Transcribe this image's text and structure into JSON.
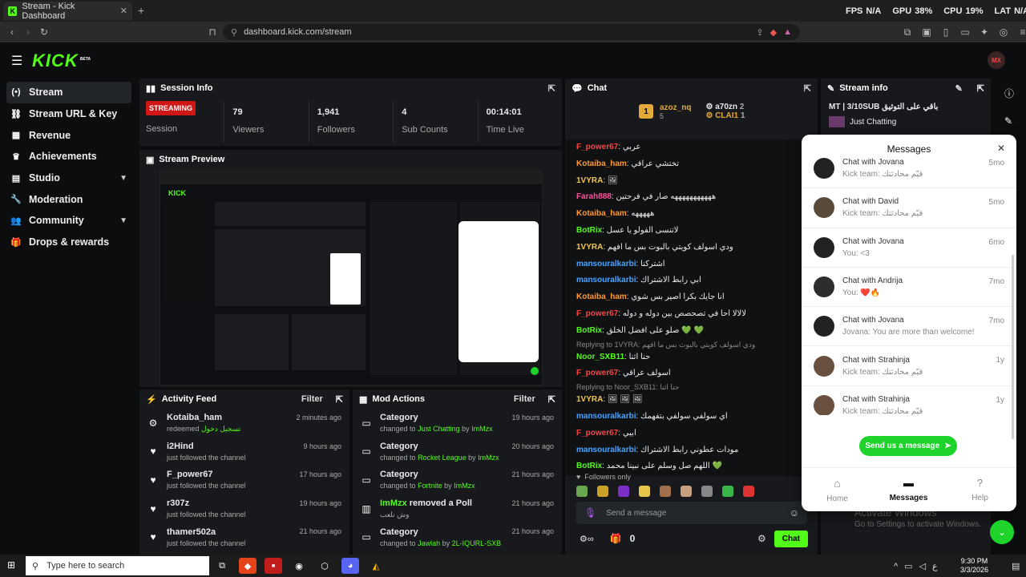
{
  "browser": {
    "tab_title": "Stream - Kick Dashboard",
    "url": "dashboard.kick.com/stream",
    "overlay": {
      "fps_label": "FPS",
      "fps": "N/A",
      "gpu_label": "GPU",
      "gpu": "38%",
      "cpu_label": "CPU",
      "cpu": "19%",
      "lat_label": "LAT",
      "lat": "N/A"
    }
  },
  "header": {
    "logo": "KICK",
    "beta": "BETA",
    "avatar": "MX"
  },
  "sidebar": {
    "items": [
      {
        "label": "Stream",
        "icon": "stream-icon"
      },
      {
        "label": "Stream URL & Key",
        "icon": "link-icon"
      },
      {
        "label": "Revenue",
        "icon": "revenue-icon"
      },
      {
        "label": "Achievements",
        "icon": "trophy-icon"
      },
      {
        "label": "Studio",
        "icon": "grid-icon"
      },
      {
        "label": "Moderation",
        "icon": "wrench-icon"
      },
      {
        "label": "Community",
        "icon": "community-icon"
      },
      {
        "label": "Drops & rewards",
        "icon": "gift-icon"
      }
    ]
  },
  "session": {
    "title": "Session Info",
    "status": "STREAMING",
    "status_label": "Session",
    "stats": [
      {
        "value": "79",
        "label": "Viewers"
      },
      {
        "value": "1,941",
        "label": "Followers"
      },
      {
        "value": "4",
        "label": "Sub Counts"
      },
      {
        "value": "00:14:01",
        "label": "Time Live"
      }
    ]
  },
  "preview": {
    "title": "Stream Preview"
  },
  "activity": {
    "title": "Activity Feed",
    "filter": "Filter",
    "items": [
      {
        "name": "Kotaiba_ham",
        "sub": "redeemed",
        "extra": "تسجيل دخول",
        "time": "2 minutes ago",
        "icon": "reward-icon"
      },
      {
        "name": "i2Hind",
        "sub": "just followed the channel",
        "time": "9 hours ago",
        "icon": "heart-icon"
      },
      {
        "name": "F_power67",
        "sub": "just followed the channel",
        "time": "17 hours ago",
        "icon": "heart-icon"
      },
      {
        "name": "r307z",
        "sub": "just followed the channel",
        "time": "19 hours ago",
        "icon": "heart-icon"
      },
      {
        "name": "thamer502a",
        "sub": "just followed the channel",
        "time": "21 hours ago",
        "icon": "heart-icon"
      }
    ]
  },
  "modactions": {
    "title": "Mod Actions",
    "filter": "Filter",
    "items": [
      {
        "title": "Category",
        "pre": "changed to",
        "target": "Just Chatting",
        "by": "by",
        "mod": "ImMzx",
        "time": "19 hours ago"
      },
      {
        "title": "Category",
        "pre": "changed to",
        "target": "Rocket League",
        "by": "by",
        "mod": "ImMzx",
        "time": "20 hours ago"
      },
      {
        "title": "Category",
        "pre": "changed to",
        "target": "Fortnite",
        "by": "by",
        "mod": "ImMzx",
        "time": "21 hours ago"
      },
      {
        "title_user": "ImMzx",
        "title": "removed a Poll",
        "pre": "وش نلعب",
        "target": "",
        "by": "",
        "mod": "",
        "time": "21 hours ago"
      },
      {
        "title": "Category",
        "pre": "changed to",
        "target": "Jawlah",
        "by": "by",
        "mod": "2L-IQURL-SXB",
        "time": "21 hours ago"
      }
    ]
  },
  "chat": {
    "title": "Chat",
    "top": [
      {
        "rank": "1",
        "name": "azoz_nq",
        "count": "5"
      },
      {
        "name": "a70zn",
        "count": "2"
      },
      {
        "name": "CLAI1",
        "count": "1"
      }
    ],
    "messages": [
      {
        "user": "F_power67",
        "color": "#ff4444",
        "text": "عربي"
      },
      {
        "user": "Kotaiba_ham",
        "color": "#ff9a2b",
        "text": "تختشي عراقي"
      },
      {
        "user": "1VYRA",
        "color": "#f2c94c",
        "text": "🖼"
      },
      {
        "user": "Farah888",
        "color": "#ff4d9d",
        "text": "هههههههههههه صار في فرحتين"
      },
      {
        "user": "Kotaiba_ham",
        "color": "#ff9a2b",
        "text": "هههههه"
      },
      {
        "user": "BotRix",
        "color": "#53fc18",
        "text": "لاتنسى الفولو يا عسل"
      },
      {
        "user": "1VYRA",
        "color": "#f2c94c",
        "text": "ودي اسولف كويتي بالبوت بس ما افهم"
      },
      {
        "user": "mansouralkarbi",
        "color": "#4aa3ff",
        "text": "اشتركنا"
      },
      {
        "user": "mansouralkarbi",
        "color": "#4aa3ff",
        "text": "ابي رابط الاشتراك"
      },
      {
        "user": "Kotaiba_ham",
        "color": "#ff9a2b",
        "text": "انا جايك بكرا اصير بس شوي"
      },
      {
        "user": "F_power67",
        "color": "#ff4444",
        "text": "لالالا احا في تصحصص بين دوله و دوله"
      },
      {
        "user": "BotRix",
        "color": "#53fc18",
        "text": "صلو على افضل الخلق 💚 💚"
      },
      {
        "reply": "Replying to 1VYRA: ودي اسولف كويتي بالبوت بس ما افهم"
      },
      {
        "user": "Noor_SXB11",
        "color": "#53fc18",
        "text": "حنا اثنا"
      },
      {
        "user": "F_power67",
        "color": "#ff4444",
        "text": "اسولف عراقي"
      },
      {
        "reply": "Replying to Noor_SXB11: حنا اثنا"
      },
      {
        "user": "1VYRA",
        "color": "#f2c94c",
        "text": "🖼 🖼 🖼"
      },
      {
        "user": "mansouralkarbi",
        "color": "#4aa3ff",
        "text": "اي سولفي سولفي بتفهمك"
      },
      {
        "user": "F_power67",
        "color": "#ff4444",
        "text": "ابيي"
      },
      {
        "user": "mansouralkarbi",
        "color": "#4aa3ff",
        "text": "مودات عطوني رابط الاشتراك"
      },
      {
        "user": "BotRix",
        "color": "#53fc18",
        "text": "اللهم صل وسلم على نبينا محمد 💚"
      }
    ],
    "followers_only": "Followers only",
    "placeholder": "Send a message",
    "points": "0",
    "send": "Chat"
  },
  "streaminfo": {
    "title": "Stream info",
    "stream_title": "MT | 3/10SUB باقي على التوثيق",
    "category": "Just Chatting"
  },
  "messages_popup": {
    "title": "Messages",
    "conversations": [
      {
        "title": "Chat with Jovana",
        "sub": "Kick team: قيّم محادثتك",
        "time": "5mo"
      },
      {
        "title": "Chat with David",
        "sub": "Kick team: قيّم محادثتك",
        "time": "5mo"
      },
      {
        "title": "Chat with Jovana",
        "sub": "You: <3",
        "time": "6mo"
      },
      {
        "title": "Chat with Andrija",
        "sub": "You: ❤️🔥",
        "time": "7mo"
      },
      {
        "title": "Chat with Jovana",
        "sub": "Jovana: You are more than welcome!  If you h...",
        "time": "7mo"
      },
      {
        "title": "Chat with Strahinja",
        "sub": "Kick team: قيّم محادثتك",
        "time": "1y"
      },
      {
        "title": "Chat with Strahinja",
        "sub": "Kick team: قيّم محادثتك",
        "time": "1y"
      }
    ],
    "send_label": "Send us a message",
    "nav": [
      {
        "label": "Home"
      },
      {
        "label": "Messages"
      },
      {
        "label": "Help"
      }
    ]
  },
  "watermark": {
    "line1": "Activate Windows",
    "line2": "Go to Settings to activate Windows."
  },
  "taskbar": {
    "search": "Type here to search",
    "time": "9:30 PM",
    "date": "3/3/2026",
    "lang": "ع"
  }
}
